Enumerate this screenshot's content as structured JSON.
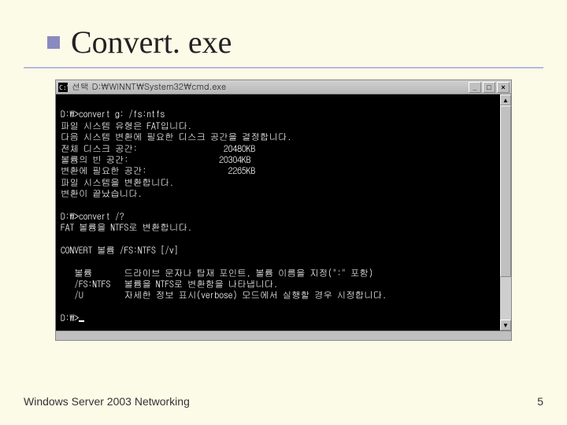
{
  "slide": {
    "title": "Convert. exe"
  },
  "window": {
    "title": "선택 D:\\WINNT\\System32\\cmd.exe",
    "sysicon_name": "cmd-icon",
    "buttons": {
      "minimize": "_",
      "maximize": "□",
      "close": "×"
    }
  },
  "console": {
    "lines": [
      "",
      "D:\\>convert g: /fs:ntfs",
      "파일 시스템 유형은 FAT입니다.",
      "다음 시스템 변환에 필요한 디스크 공간을 결정합니다.",
      "전체 디스크 공간:                   20480KB",
      "볼륨의 빈 공간:                    20304KB",
      "변환에 필요한 공간:                  2265KB",
      "파일 시스템을 변환합니다.",
      "변환이 끝났습니다.",
      "",
      "D:\\>convert /?",
      "FAT 볼륨을 NTFS로 변환합니다.",
      "",
      "CONVERT 볼륨 /FS:NTFS [/v]",
      "",
      "   볼륨       드라이브 문자나 탑재 포인트, 볼륨 이름을 지정(\":\" 포함)",
      "   /FS:NTFS   볼륨을 NTFS로 변환함을 나타냅니다.",
      "   /U         자세한 정보 표시(verbose) 모드에서 실행할 경우 시정합니다.",
      "",
      "D:\\>"
    ]
  },
  "footer": {
    "left": "Windows  Server 2003 Networking",
    "page": "5"
  }
}
